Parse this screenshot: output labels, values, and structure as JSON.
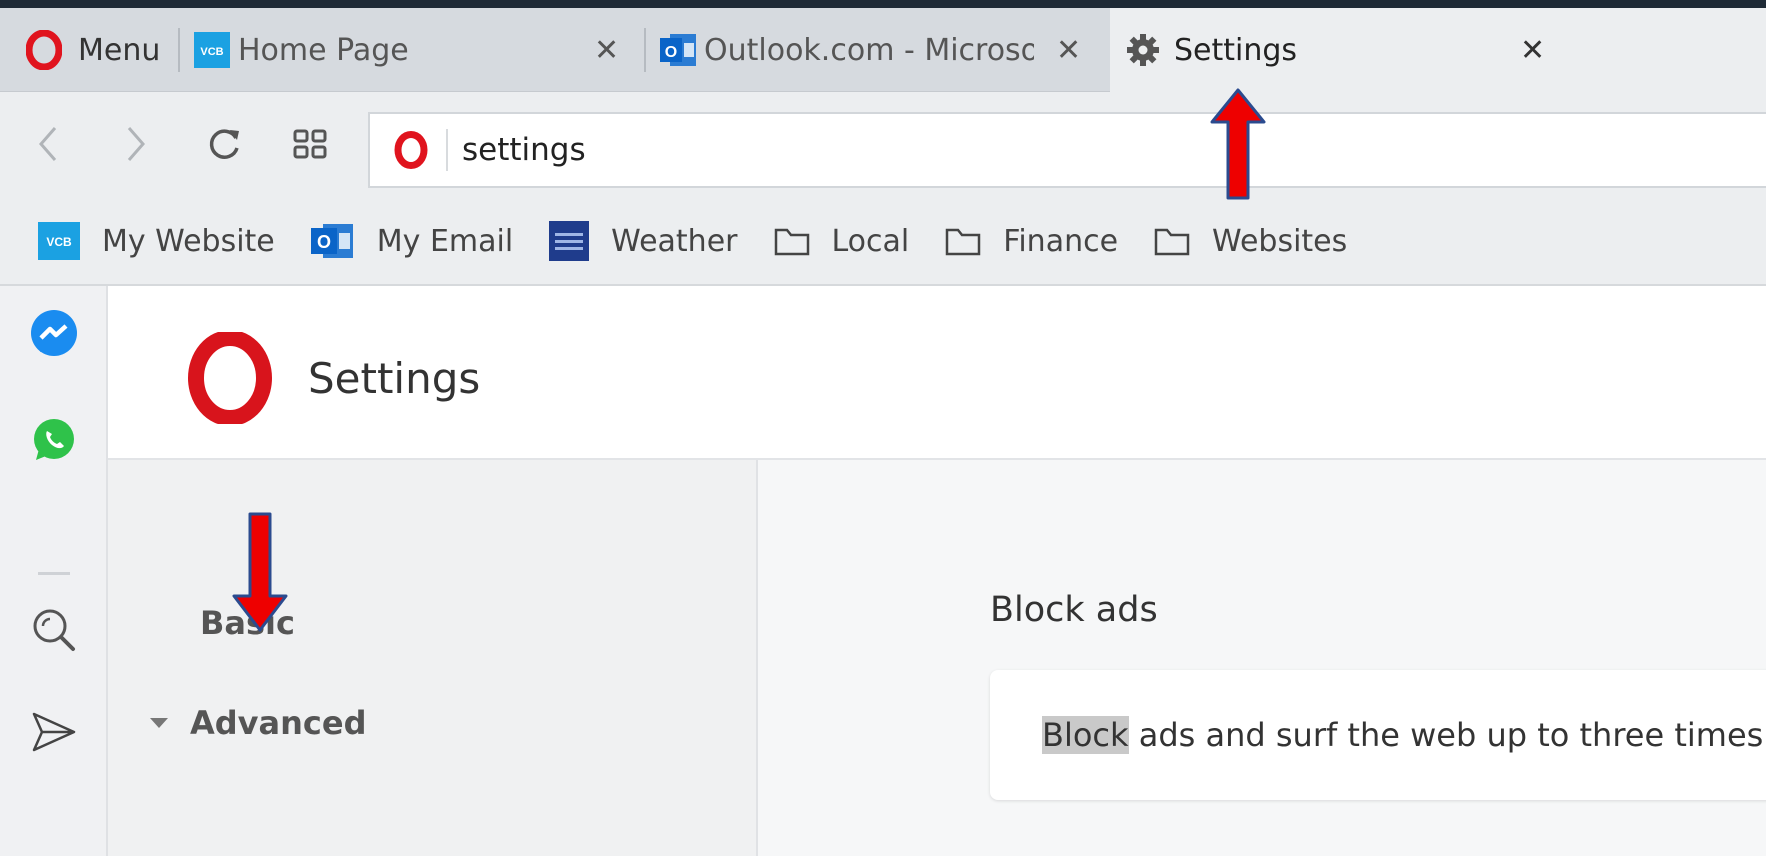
{
  "tabs": {
    "menu_label": "Menu",
    "items": [
      {
        "title": "Home Page",
        "icon": "vcb-icon"
      },
      {
        "title": "Outlook.com - Microsoft f",
        "icon": "outlook-icon"
      },
      {
        "title": "Settings",
        "icon": "gear-icon",
        "active": true
      }
    ],
    "vcb_badge": "VCB",
    "outlook_badge": "O"
  },
  "address_bar": {
    "url": "settings"
  },
  "bookmarks": [
    {
      "label": "My Website",
      "icon": "vcb-icon"
    },
    {
      "label": "My Email",
      "icon": "outlook-icon"
    },
    {
      "label": "Weather",
      "icon": "weather-channel-icon"
    },
    {
      "label": "Local",
      "icon": "folder-icon"
    },
    {
      "label": "Finance",
      "icon": "folder-icon"
    },
    {
      "label": "Websites",
      "icon": "folder-icon"
    }
  ],
  "sidebar": [
    "messenger-icon",
    "whatsapp-icon",
    "search-icon",
    "send-icon"
  ],
  "page": {
    "title": "Settings",
    "nav": {
      "basic": "Basic",
      "advanced": "Advanced"
    },
    "section_title": "Block ads",
    "card_highlight": "Block",
    "card_text": " ads and surf the web up to three times faster"
  },
  "colors": {
    "opera_red": "#e0141e",
    "vcb_blue": "#1ba1e2",
    "outlook_blue": "#0a64c8",
    "annotation_red": "#ee0000",
    "annotation_outline": "#2b4b8f"
  }
}
